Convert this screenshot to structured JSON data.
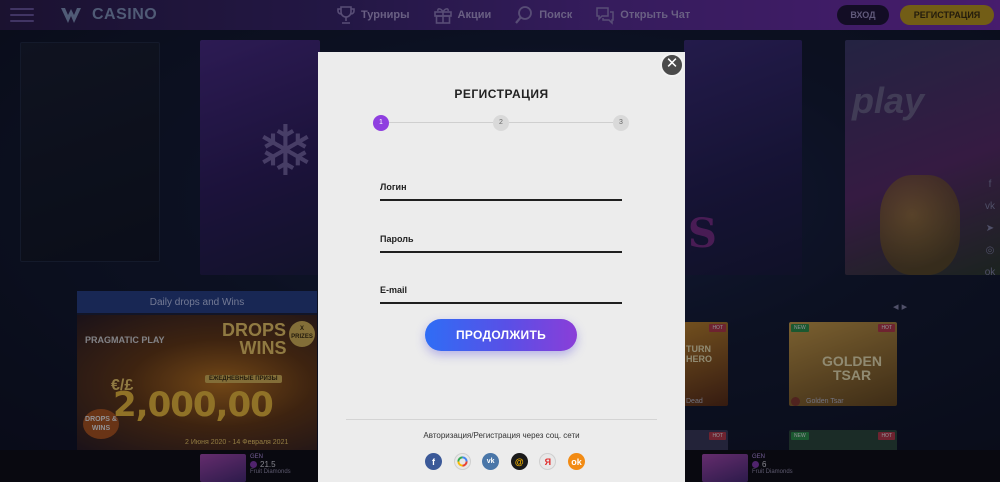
{
  "header": {
    "logo_text": "CASINO",
    "nav": [
      {
        "label": "Турниры",
        "icon": "trophy-icon"
      },
      {
        "label": "Акции",
        "icon": "gift-icon"
      },
      {
        "label": "Поиск",
        "icon": "search-icon"
      },
      {
        "label": "Открыть Чат",
        "icon": "chat-icon"
      }
    ],
    "login_label": "ВХОД",
    "register_label": "РЕГИСТРАЦИЯ"
  },
  "background": {
    "drops_header": "Daily drops and Wins",
    "drops_provider": "PRAGMATIC PLAY",
    "drops_title": "DROPS & WINS",
    "drops_subtitle": "ЕЖЕДНЕВНЫЕ ПРИЗЫ",
    "drops_prize_badge": "X PRIZES",
    "drops_currency": "€/£",
    "drops_amount": "2,000,00",
    "drops_mini_badge": "DROPS & WINS",
    "drops_dates": "2 Июня 2020 - 14 Февраля 2021",
    "game1_badge": "HOT",
    "game1_title": "TURN HERO",
    "game1_label": "Dead",
    "game2_new": "NEW",
    "game2_hot": "HOT",
    "game2_title": "GOLDEN TSAR",
    "game2_label": "Golden Tsar",
    "game3_badge": "HOT",
    "game4_new": "NEW",
    "game4_hot": "HOT",
    "play_logo": "play",
    "side_icons": [
      "facebook-icon",
      "vk-icon",
      "telegram-icon",
      "instagram-icon",
      "odnoklassniki-icon"
    ]
  },
  "ticker": [
    {
      "gen": "GEN",
      "value": "21.5",
      "name": "Fruit Diamonds"
    },
    {
      "gen": "GEN",
      "value": "6",
      "name": "Fruit Diamonds"
    }
  ],
  "modal": {
    "title": "РЕГИСТРАЦИЯ",
    "steps": [
      "1",
      "2",
      "3"
    ],
    "active_step": 1,
    "fields": [
      {
        "label": "Логин"
      },
      {
        "label": "Пароль"
      },
      {
        "label": "E-mail"
      }
    ],
    "continue_label": "ПРОДОЛЖИТЬ",
    "social_text": "Авторизация/Регистрация через соц. сети",
    "social": [
      {
        "name": "facebook",
        "glyph": "f"
      },
      {
        "name": "google",
        "glyph": "G"
      },
      {
        "name": "vk",
        "glyph": "vk"
      },
      {
        "name": "mail-ru",
        "glyph": "@"
      },
      {
        "name": "yandex",
        "glyph": "Я"
      },
      {
        "name": "odnoklassniki",
        "glyph": "ok"
      }
    ]
  },
  "colors": {
    "accent_purple": "#8f3fe0",
    "register_gold": "#c8a21a",
    "continue_blue": "#2f6df5"
  }
}
